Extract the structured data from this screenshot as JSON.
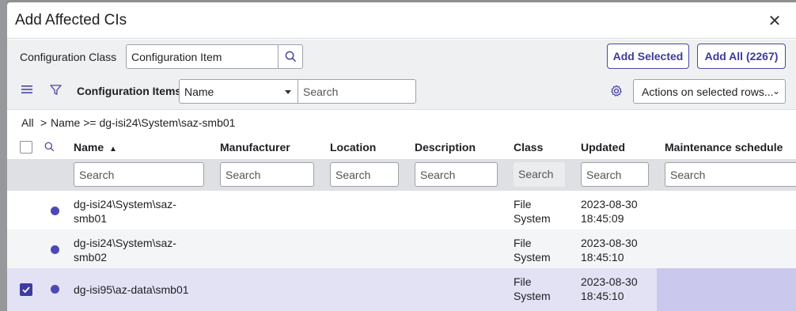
{
  "dialog": {
    "title": "Add Affected CIs",
    "close_symbol": "✕"
  },
  "filter_bar": {
    "label": "Configuration Class",
    "class_value": "Configuration Item",
    "add_selected_label": "Add Selected",
    "add_all_label": "Add All (2267)"
  },
  "toolbar": {
    "list_label": "Configuration Items",
    "search_field": "Name",
    "search_placeholder": "Search",
    "actions_label": "Actions on selected rows..."
  },
  "breadcrumb": {
    "root": "All",
    "separator": ">",
    "condition": "Name >= dg-isi24\\System\\saz-smb01"
  },
  "table": {
    "columns": [
      "Name",
      "Manufacturer",
      "Location",
      "Description",
      "Class",
      "Updated",
      "Maintenance schedule"
    ],
    "sort_indicator": "▲",
    "search_placeholder": "Search",
    "rows": [
      {
        "name_line1": "dg-isi24\\System\\saz-",
        "name_line2": "smb01",
        "class_line1": "File",
        "class_line2": "System",
        "updated_line1": "2023-08-30",
        "updated_line2": "18:45:09",
        "selected": false
      },
      {
        "name_line1": "dg-isi24\\System\\saz-",
        "name_line2": "smb02",
        "class_line1": "File",
        "class_line2": "System",
        "updated_line1": "2023-08-30",
        "updated_line2": "18:45:10",
        "selected": false
      },
      {
        "name_line1": "dg-isi95\\az-data\\smb01",
        "name_line2": "",
        "class_line1": "File",
        "class_line2": "System",
        "updated_line1": "2023-08-30",
        "updated_line2": "18:45:10",
        "selected": true
      }
    ]
  },
  "colors": {
    "accent": "#4a46a8",
    "status_dot": "#4d48b8",
    "selected_row": "#e3e2f4"
  }
}
